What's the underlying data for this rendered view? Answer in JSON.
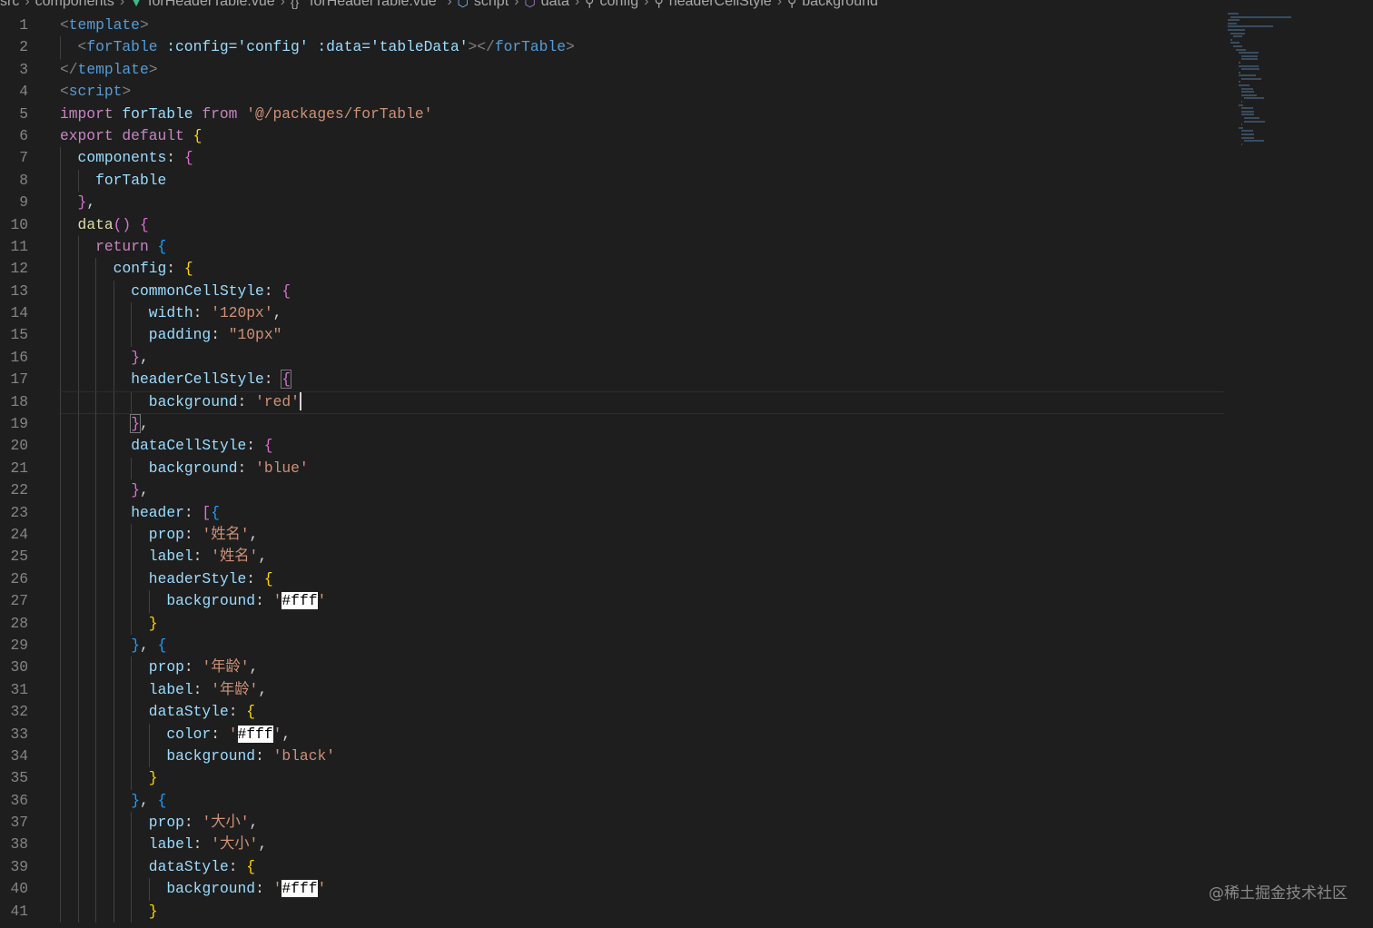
{
  "breadcrumb": [
    "src",
    "components",
    "forHeaderTable.vue",
    "\"forHeaderTable.vue\"",
    "script",
    "data",
    "config",
    "headerCellStyle",
    "background"
  ],
  "breadcrumb_icons": [
    "",
    "",
    "vue-icon",
    "braces-icon",
    "cube-icon",
    "cube-icon",
    "wrench-icon",
    "wrench-icon",
    "wrench-icon"
  ],
  "current_line": 18,
  "watermark": "@稀土掘金技术社区",
  "lines": [
    {
      "i": 0,
      "t": [
        [
          "<",
          "p"
        ],
        [
          "template",
          "tag"
        ],
        [
          ">",
          "p"
        ]
      ]
    },
    {
      "i": 1,
      "t": [
        [
          "<",
          "p"
        ],
        [
          "forTable",
          "tag"
        ],
        [
          " :config=",
          "attr"
        ],
        [
          "'config'",
          "attr"
        ],
        [
          " :data=",
          "attr"
        ],
        [
          "'tableData'",
          "attr"
        ],
        [
          "></",
          "p"
        ],
        [
          "forTable",
          "tag"
        ],
        [
          ">",
          "p"
        ]
      ]
    },
    {
      "i": 0,
      "t": [
        [
          "</",
          "p"
        ],
        [
          "template",
          "tag"
        ],
        [
          ">",
          "p"
        ]
      ]
    },
    {
      "i": 0,
      "t": [
        [
          "<",
          "p"
        ],
        [
          "script",
          "tag"
        ],
        [
          ">",
          "p"
        ]
      ]
    },
    {
      "i": 0,
      "t": [
        [
          "import ",
          "kw"
        ],
        [
          "forTable ",
          "var"
        ],
        [
          "from ",
          "kw"
        ],
        [
          "'@/packages/forTable'",
          "str"
        ]
      ]
    },
    {
      "i": 0,
      "t": [
        [
          "export ",
          "kw"
        ],
        [
          "default ",
          "kw"
        ],
        [
          "{",
          "b1"
        ]
      ]
    },
    {
      "i": 1,
      "t": [
        [
          "components",
          "var"
        ],
        [
          ": ",
          "txt"
        ],
        [
          "{",
          "b2"
        ]
      ]
    },
    {
      "i": 2,
      "t": [
        [
          "forTable",
          "var"
        ]
      ]
    },
    {
      "i": 1,
      "t": [
        [
          "}",
          "b2"
        ],
        [
          ",",
          "txt"
        ]
      ]
    },
    {
      "i": 1,
      "t": [
        [
          "data",
          "fn"
        ],
        [
          "()",
          "b2"
        ],
        [
          " ",
          "txt"
        ],
        [
          "{",
          "b2"
        ]
      ]
    },
    {
      "i": 2,
      "t": [
        [
          "return ",
          "kw"
        ],
        [
          "{",
          "b3"
        ]
      ]
    },
    {
      "i": 3,
      "t": [
        [
          "config",
          "var"
        ],
        [
          ": ",
          "txt"
        ],
        [
          "{",
          "b1"
        ]
      ]
    },
    {
      "i": 4,
      "t": [
        [
          "commonCellStyle",
          "var"
        ],
        [
          ": ",
          "txt"
        ],
        [
          "{",
          "b2"
        ]
      ]
    },
    {
      "i": 5,
      "t": [
        [
          "width",
          "var"
        ],
        [
          ": ",
          "txt"
        ],
        [
          "'120px'",
          "str"
        ],
        [
          ",",
          "txt"
        ]
      ]
    },
    {
      "i": 5,
      "t": [
        [
          "padding",
          "var"
        ],
        [
          ": ",
          "txt"
        ],
        [
          "\"10px\"",
          "str"
        ]
      ]
    },
    {
      "i": 4,
      "t": [
        [
          "}",
          "b2"
        ],
        [
          ",",
          "txt"
        ]
      ]
    },
    {
      "i": 4,
      "t": [
        [
          "headerCellStyle",
          "var"
        ],
        [
          ": ",
          "txt"
        ],
        [
          "{",
          "b2 bm"
        ]
      ]
    },
    {
      "i": 5,
      "t": [
        [
          "background",
          "var"
        ],
        [
          ": ",
          "txt"
        ],
        [
          "'red'",
          "str"
        ]
      ],
      "cursor": true
    },
    {
      "i": 4,
      "t": [
        [
          "}",
          "b2 bm"
        ],
        [
          ",",
          "txt"
        ]
      ]
    },
    {
      "i": 4,
      "t": [
        [
          "dataCellStyle",
          "var"
        ],
        [
          ": ",
          "txt"
        ],
        [
          "{",
          "b2"
        ]
      ]
    },
    {
      "i": 5,
      "t": [
        [
          "background",
          "var"
        ],
        [
          ": ",
          "txt"
        ],
        [
          "'blue'",
          "str"
        ]
      ]
    },
    {
      "i": 4,
      "t": [
        [
          "}",
          "b2"
        ],
        [
          ",",
          "txt"
        ]
      ]
    },
    {
      "i": 4,
      "t": [
        [
          "header",
          "var"
        ],
        [
          ": ",
          "txt"
        ],
        [
          "[",
          "b2"
        ],
        [
          "{",
          "b3"
        ]
      ]
    },
    {
      "i": 5,
      "t": [
        [
          "prop",
          "var"
        ],
        [
          ": ",
          "txt"
        ],
        [
          "'姓名'",
          "str"
        ],
        [
          ",",
          "txt"
        ]
      ]
    },
    {
      "i": 5,
      "t": [
        [
          "label",
          "var"
        ],
        [
          ": ",
          "txt"
        ],
        [
          "'姓名'",
          "str"
        ],
        [
          ",",
          "txt"
        ]
      ]
    },
    {
      "i": 5,
      "t": [
        [
          "headerStyle",
          "var"
        ],
        [
          ": ",
          "txt"
        ],
        [
          "{",
          "b1"
        ]
      ]
    },
    {
      "i": 6,
      "t": [
        [
          "background",
          "var"
        ],
        [
          ": ",
          "txt"
        ],
        [
          "'",
          "str"
        ],
        [
          "#fff",
          "hl"
        ],
        [
          "'",
          "str"
        ]
      ]
    },
    {
      "i": 5,
      "t": [
        [
          "}",
          "b1"
        ]
      ]
    },
    {
      "i": 4,
      "t": [
        [
          "}",
          "b3"
        ],
        [
          ", ",
          "txt"
        ],
        [
          "{",
          "b3"
        ]
      ]
    },
    {
      "i": 5,
      "t": [
        [
          "prop",
          "var"
        ],
        [
          ": ",
          "txt"
        ],
        [
          "'年龄'",
          "str"
        ],
        [
          ",",
          "txt"
        ]
      ]
    },
    {
      "i": 5,
      "t": [
        [
          "label",
          "var"
        ],
        [
          ": ",
          "txt"
        ],
        [
          "'年龄'",
          "str"
        ],
        [
          ",",
          "txt"
        ]
      ]
    },
    {
      "i": 5,
      "t": [
        [
          "dataStyle",
          "var"
        ],
        [
          ": ",
          "txt"
        ],
        [
          "{",
          "b1"
        ]
      ]
    },
    {
      "i": 6,
      "t": [
        [
          "color",
          "var"
        ],
        [
          ": ",
          "txt"
        ],
        [
          "'",
          "str"
        ],
        [
          "#fff",
          "hl"
        ],
        [
          "'",
          "str"
        ],
        [
          ",",
          "txt"
        ]
      ]
    },
    {
      "i": 6,
      "t": [
        [
          "background",
          "var"
        ],
        [
          ": ",
          "txt"
        ],
        [
          "'black'",
          "str"
        ]
      ]
    },
    {
      "i": 5,
      "t": [
        [
          "}",
          "b1"
        ]
      ]
    },
    {
      "i": 4,
      "t": [
        [
          "}",
          "b3"
        ],
        [
          ", ",
          "txt"
        ],
        [
          "{",
          "b3"
        ]
      ]
    },
    {
      "i": 5,
      "t": [
        [
          "prop",
          "var"
        ],
        [
          ": ",
          "txt"
        ],
        [
          "'大小'",
          "str"
        ],
        [
          ",",
          "txt"
        ]
      ]
    },
    {
      "i": 5,
      "t": [
        [
          "label",
          "var"
        ],
        [
          ": ",
          "txt"
        ],
        [
          "'大小'",
          "str"
        ],
        [
          ",",
          "txt"
        ]
      ]
    },
    {
      "i": 5,
      "t": [
        [
          "dataStyle",
          "var"
        ],
        [
          ": ",
          "txt"
        ],
        [
          "{",
          "b1"
        ]
      ]
    },
    {
      "i": 6,
      "t": [
        [
          "background",
          "var"
        ],
        [
          ": ",
          "txt"
        ],
        [
          "'",
          "str"
        ],
        [
          "#fff",
          "hl"
        ],
        [
          "'",
          "str"
        ]
      ]
    },
    {
      "i": 5,
      "t": [
        [
          "}",
          "b1"
        ]
      ]
    }
  ]
}
